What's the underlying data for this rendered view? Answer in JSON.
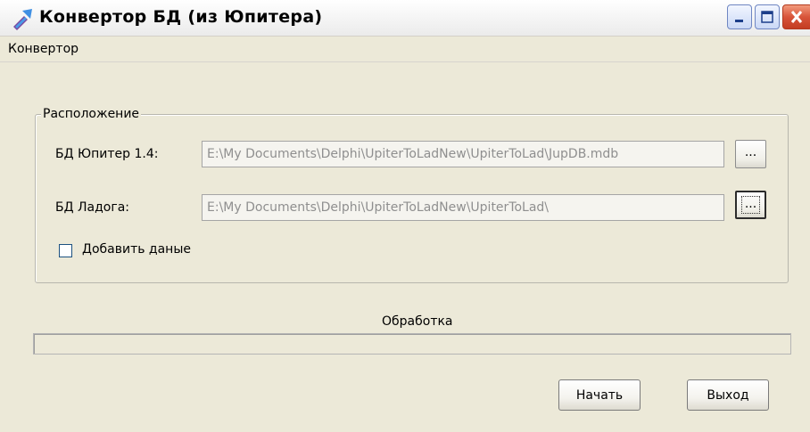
{
  "window": {
    "title": "Конвертор БД (из Юпитера)",
    "app_icon": "arrow-icon",
    "controls": [
      "minimize-icon",
      "maximize-icon",
      "close-icon"
    ]
  },
  "menu": {
    "items": [
      {
        "label": "Конвертор"
      }
    ]
  },
  "location_group": {
    "legend": "Расположение",
    "jupiter": {
      "label": "БД Юпитер 1.4:",
      "value": "E:\\My Documents\\Delphi\\UpiterToLadNew\\UpiterToLad\\JupDB.mdb",
      "browse_label": "..."
    },
    "ladoga": {
      "label": "БД Ладога:",
      "value": "E:\\My Documents\\Delphi\\UpiterToLadNew\\UpiterToLad\\",
      "browse_label": "..."
    },
    "append": {
      "label": "Добавить даные",
      "checked": false
    }
  },
  "progress": {
    "label": "Обработка",
    "value": 0
  },
  "buttons": {
    "start": "Начать",
    "exit": "Выход"
  },
  "colors": {
    "window_background": "#ece9d8",
    "close_button": "#d8553a",
    "control_button": "#cad8f6"
  }
}
